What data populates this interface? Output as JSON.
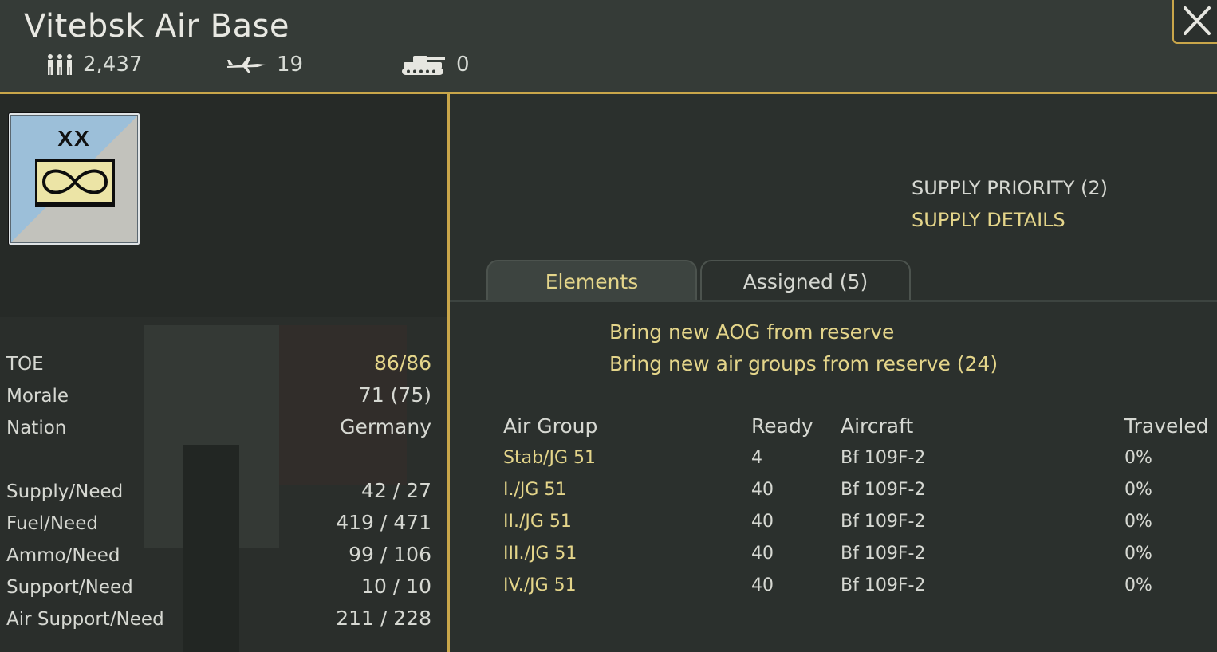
{
  "header": {
    "title": "Vitebsk Air Base",
    "men_count": "2,437",
    "aircraft_count": "19",
    "tank_count": "0",
    "icons": [
      "men-icon",
      "aircraft-icon",
      "tank-icon",
      "close-icon"
    ]
  },
  "counter": {
    "size_label": "XX",
    "symbol": "air-base-symbol-icon"
  },
  "stats": [
    {
      "label": "TOE",
      "value": "86/86",
      "highlight": true
    },
    {
      "label": "Morale",
      "value": "71 (75)",
      "highlight": false
    },
    {
      "label": "Nation",
      "value": "Germany",
      "highlight": false
    },
    {
      "label": "Supply/Need",
      "value": "42 / 27",
      "highlight": false
    },
    {
      "label": "Fuel/Need",
      "value": "419 / 471",
      "highlight": false
    },
    {
      "label": "Ammo/Need",
      "value": "99 / 106",
      "highlight": false
    },
    {
      "label": "Support/Need",
      "value": "10 / 10",
      "highlight": false
    },
    {
      "label": "Air Support/Need",
      "value": "211 / 228",
      "highlight": false
    }
  ],
  "supply": {
    "priority": "SUPPLY PRIORITY (2)",
    "details": "SUPPLY DETAILS"
  },
  "tabs": [
    {
      "label": "Elements",
      "active": true
    },
    {
      "label": "Assigned (5)",
      "active": false
    }
  ],
  "actions": {
    "new_aog": "Bring new AOG from reserve",
    "new_air_groups": "Bring new air groups from reserve (24)"
  },
  "table": {
    "headers": [
      "Air Group",
      "Ready",
      "Aircraft",
      "Traveled"
    ],
    "rows": [
      [
        "Stab/JG 51",
        "4",
        "Bf 109F-2",
        "0%"
      ],
      [
        "I./JG 51",
        "40",
        "Bf 109F-2",
        "0%"
      ],
      [
        "II./JG 51",
        "40",
        "Bf 109F-2",
        "0%"
      ],
      [
        "III./JG 51",
        "40",
        "Bf 109F-2",
        "0%"
      ],
      [
        "IV./JG 51",
        "40",
        "Bf 109F-2",
        "0%"
      ]
    ]
  },
  "colors": {
    "accent_gold": "#c9a64a",
    "highlight_text": "#e4d58a",
    "text": "#d6d8d2",
    "counter_blue": "#9cbfd9",
    "counter_grey": "#c2c2bc"
  }
}
